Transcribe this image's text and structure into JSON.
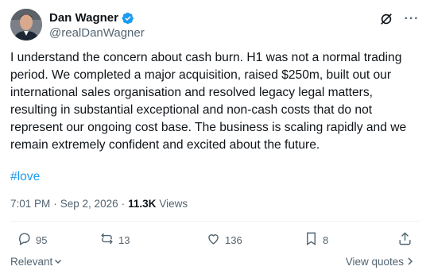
{
  "author": {
    "name": "Dan Wagner",
    "handle": "@realDanWagner",
    "verified": true,
    "verified_color": "#1d9bf0"
  },
  "tweet": {
    "text": "I understand the concern about cash burn. H1 was not a normal trading period. We completed a major acquisition, raised $250m, built out our international sales organisation and resolved legacy legal matters, resulting in substantial exceptional and non-cash costs that do not represent our ongoing cost base. The business is scaling rapidly and we remain extremely confident and excited about the future.",
    "hashtag": "#love",
    "time": "7:01 PM",
    "date": "Sep 2, 2026",
    "views_count": "11.3K",
    "views_label": "Views"
  },
  "actions": {
    "replies": "95",
    "reposts": "13",
    "likes": "136",
    "bookmarks": "8"
  },
  "footer": {
    "relevant_label": "Relevant",
    "view_quotes_label": "View quotes"
  },
  "colors": {
    "text": "#0f1419",
    "muted": "#536471",
    "link": "#1d9bf0",
    "divider": "#eff3f4"
  }
}
